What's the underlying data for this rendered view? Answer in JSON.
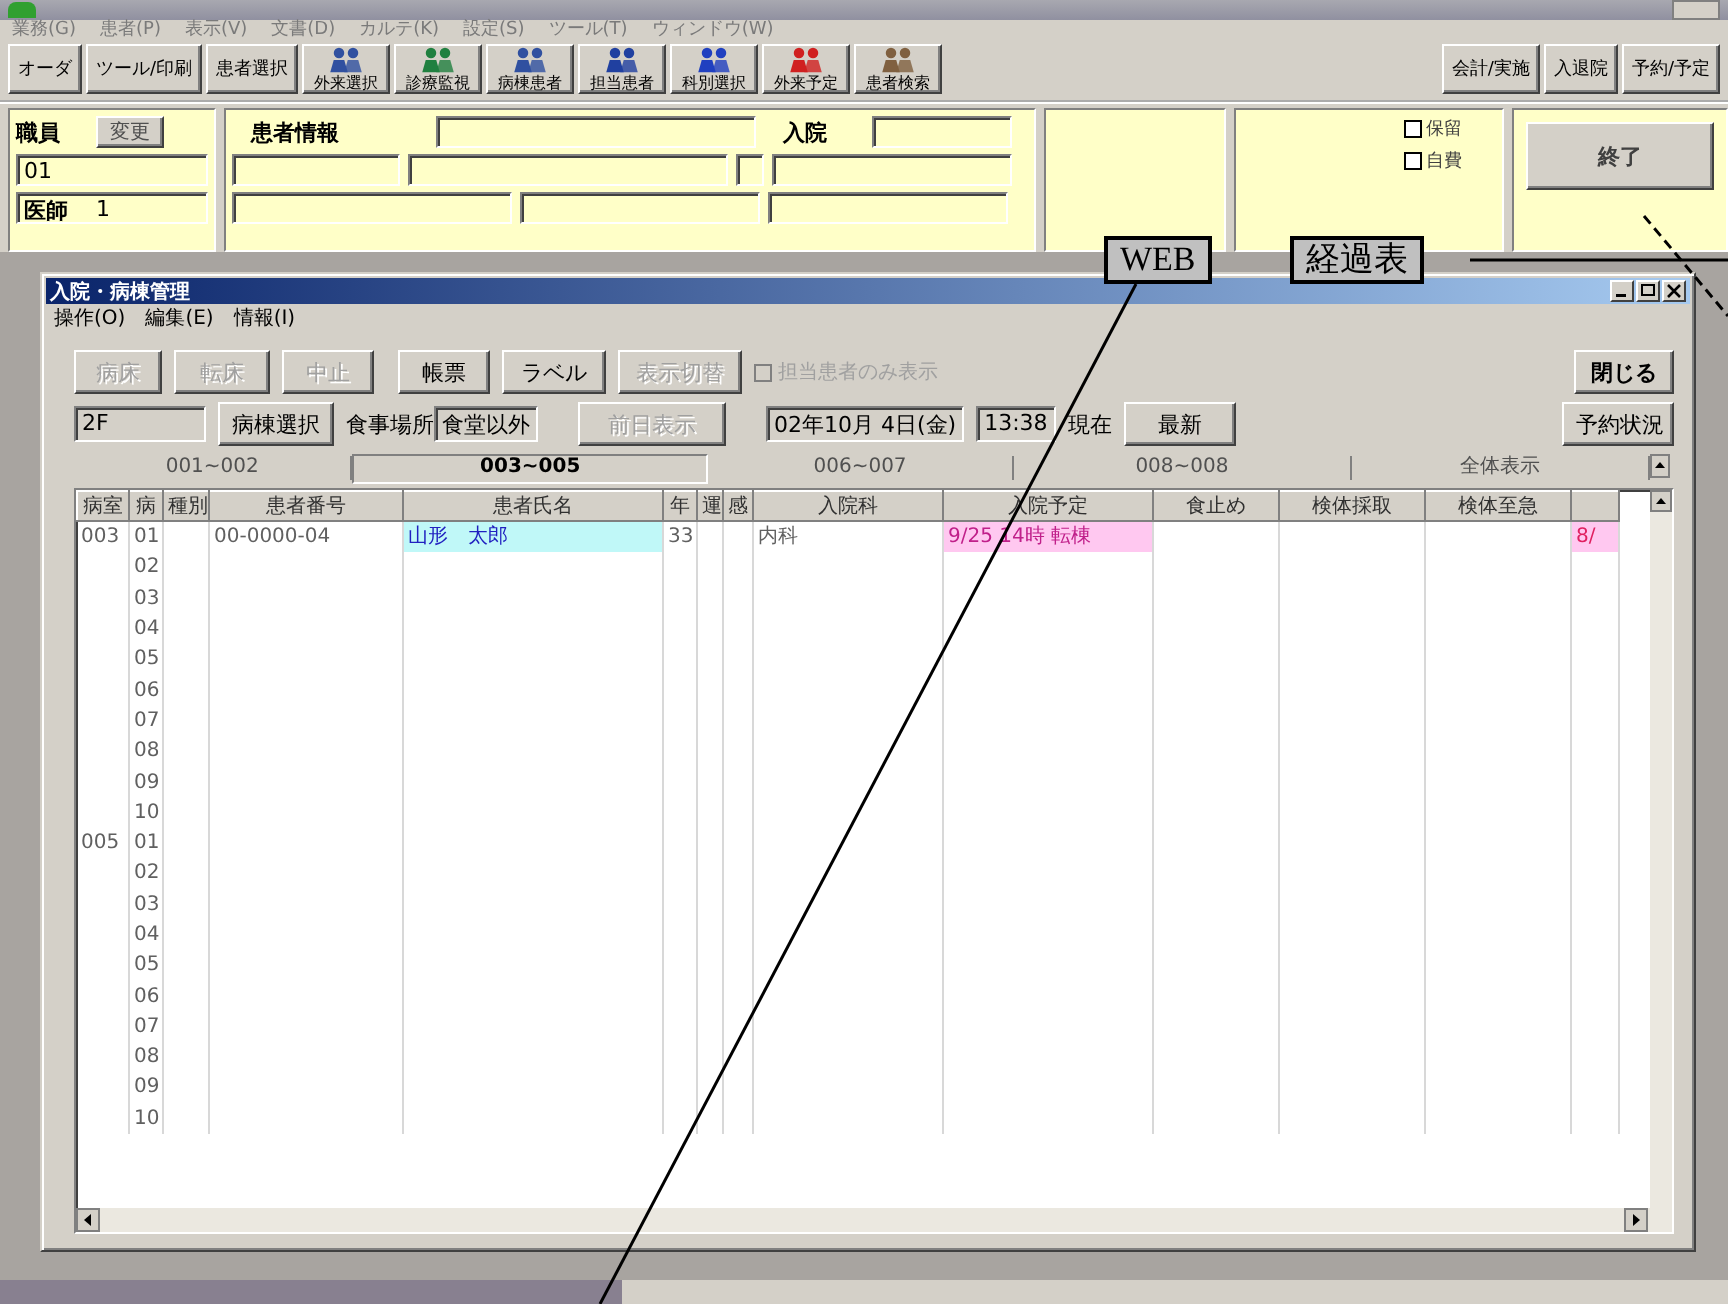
{
  "main_window": {
    "menu": [
      "業務(G)",
      "患者(P)",
      "表示(V)",
      "文書(D)",
      "カルテ(K)",
      "設定(S)",
      "ツール(T)",
      "ウィンドウ(W)"
    ],
    "toolbar": [
      {
        "kind": "text",
        "label": "オーダ"
      },
      {
        "kind": "text",
        "label": "ツール/印刷"
      },
      {
        "kind": "text",
        "label": "患者選択"
      },
      {
        "kind": "icon",
        "label": "外来選択"
      },
      {
        "kind": "icon",
        "label": "診療監視"
      },
      {
        "kind": "icon",
        "label": "病棟患者"
      },
      {
        "kind": "icon",
        "label": "担当患者"
      },
      {
        "kind": "icon",
        "label": "科別選択"
      },
      {
        "kind": "icon",
        "label": "外来予定"
      },
      {
        "kind": "icon",
        "label": "患者検索"
      }
    ],
    "right_toolbar": [
      "会計/実施",
      "入退院",
      "予約/予定"
    ],
    "staff": {
      "label": "職員",
      "change_button": "変更",
      "id": "01",
      "role": "医師",
      "number": "1"
    },
    "patient": {
      "label": "患者情報",
      "admission_label": "入院"
    },
    "checkboxes": [
      {
        "label": "保留",
        "checked": false
      },
      {
        "label": "自費",
        "checked": false
      }
    ],
    "exit_button": "終了"
  },
  "callouts": [
    {
      "label": "WEB"
    },
    {
      "label": "経過表"
    }
  ],
  "dialog": {
    "title": "入院・病棟管理",
    "menu": [
      "操作(O)",
      "編集(E)",
      "情報(I)"
    ],
    "buttons": [
      {
        "label": "病床",
        "disabled": true
      },
      {
        "label": "転床",
        "disabled": true
      },
      {
        "label": "中止",
        "disabled": true
      },
      {
        "label": "帳票",
        "disabled": false
      },
      {
        "label": "ラベル",
        "disabled": false
      },
      {
        "label": "表示切替",
        "disabled": true
      }
    ],
    "filter_checkbox": {
      "label": "担当患者のみ表示",
      "checked": false,
      "disabled": true
    },
    "close_button": "閉じる",
    "floor": "2F",
    "ward_button": "病棟選択",
    "meal_label": "食事場所",
    "meal_value": "食堂以外",
    "prev_button": {
      "label": "前日表示",
      "disabled": true
    },
    "date": "02年10月 4日(金)",
    "time": "13:38",
    "now_label": "現在",
    "refresh_button": "最新",
    "reservation_button": "予約状況",
    "ranges": [
      {
        "label": "001~002",
        "selected": false
      },
      {
        "label": "003~005",
        "selected": true
      },
      {
        "label": "006~007",
        "selected": false
      },
      {
        "label": "008~008",
        "selected": false
      },
      {
        "label": "全体表示",
        "selected": false
      }
    ],
    "table": {
      "columns": [
        "病室",
        "病",
        "種別",
        "患者番号",
        "患者氏名",
        "年",
        "運",
        "感",
        "入院科",
        "入院予定",
        "食止め",
        "検体採取",
        "検体至急"
      ],
      "rows": [
        {
          "room": "003",
          "bed": "01",
          "patient_no": "00-0000-04",
          "name": "山形　太郎",
          "age": "33",
          "dept": "内科",
          "planned": "9/25 14時 転棟",
          "column_14": "8/"
        },
        {
          "bed": "02"
        },
        {
          "bed": "03"
        },
        {
          "bed": "04"
        },
        {
          "bed": "05"
        },
        {
          "bed": "06"
        },
        {
          "bed": "07"
        },
        {
          "bed": "08"
        },
        {
          "bed": "09"
        },
        {
          "bed": "10"
        },
        {
          "room": "005",
          "bed": "01"
        },
        {
          "bed": "02"
        },
        {
          "bed": "03"
        },
        {
          "bed": "04"
        },
        {
          "bed": "05"
        },
        {
          "bed": "06"
        },
        {
          "bed": "07"
        },
        {
          "bed": "08"
        },
        {
          "bed": "09"
        },
        {
          "bed": "10"
        }
      ]
    }
  }
}
